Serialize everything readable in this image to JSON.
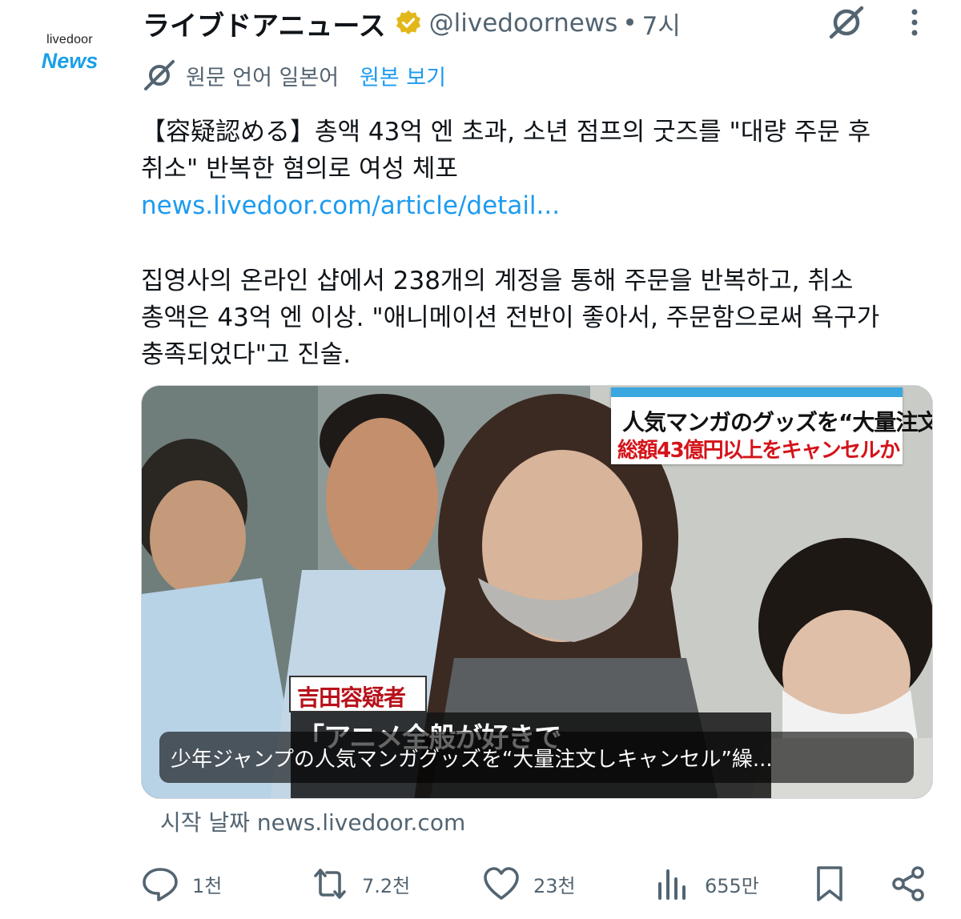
{
  "account": {
    "avatar_top": "livedoor",
    "avatar_bottom": "News",
    "display_name": "ライブドアニュース",
    "handle": "@livedoornews",
    "separator": "•",
    "time": "7시"
  },
  "translation": {
    "label": "원문 언어 일본어",
    "link": "원본 보기"
  },
  "tweet": {
    "line1": "【容疑認める】총액 43억 엔 초과, 소년 점프의 굿즈를 \"대량 주문 후",
    "line2": "취소\" 반복한 혐의로 여성 체포",
    "link": "news.livedoor.com/article/detail...",
    "para2_line1": "집영사의 온라인 샵에서 238개의 계정을 통해 주문을 반복하고, 취소",
    "para2_line2": "총액은 43억 엔 이상. \"애니메이션 전반이 좋아서, 주문함으로써 욕구가",
    "para2_line3": "충족되었다\"고 진술."
  },
  "media": {
    "tv_caption_line1": "人気マンガのグッズを“大量注文”",
    "tv_caption_line2": "総額43億円以上をキャンセルか",
    "tv_name": "吉田容疑者",
    "tv_quote": "「アニメ全般が好きで",
    "card_title": "少年ジャンプの人気マンガグッズを“大量注文しキャンセル”繰..."
  },
  "source": "시작 날짜 news.livedoor.com",
  "actions": {
    "replies": "1천",
    "reposts": "7.2천",
    "likes": "23천",
    "views": "655만"
  },
  "colors": {
    "accent": "#1d9bf0",
    "muted": "#536471",
    "verified": "#e2b719"
  },
  "icons": [
    "verified-badge-icon",
    "translate-icon",
    "more-icon",
    "reply-icon",
    "repost-icon",
    "like-icon",
    "views-icon",
    "bookmark-icon",
    "share-icon"
  ]
}
